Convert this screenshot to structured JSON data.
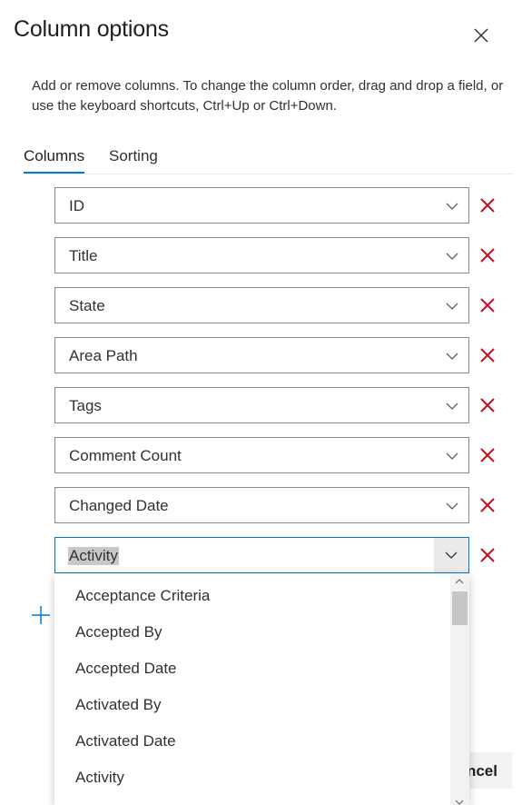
{
  "dialog": {
    "title": "Column options",
    "description": "Add or remove columns. To change the column order, drag and drop a field, or use the keyboard shortcuts, Ctrl+Up or Ctrl+Down."
  },
  "tabs": [
    {
      "label": "Columns",
      "active": true
    },
    {
      "label": "Sorting",
      "active": false
    }
  ],
  "columns": [
    {
      "value": "ID"
    },
    {
      "value": "Title"
    },
    {
      "value": "State"
    },
    {
      "value": "Area Path"
    },
    {
      "value": "Tags"
    },
    {
      "value": "Comment Count"
    },
    {
      "value": "Changed Date"
    },
    {
      "value": "Activity",
      "focused": true
    }
  ],
  "dropdown": {
    "options": [
      "Acceptance Criteria",
      "Accepted By",
      "Accepted Date",
      "Activated By",
      "Activated Date",
      "Activity"
    ]
  },
  "footer": {
    "cancel_label": "ncel"
  },
  "icons": {
    "close": "close-icon",
    "chevron": "chevron-down-icon",
    "delete": "delete-x-icon",
    "add": "plus-icon"
  },
  "colors": {
    "accent": "#0078d4",
    "delete": "#c50f1f",
    "text": "#323130"
  }
}
